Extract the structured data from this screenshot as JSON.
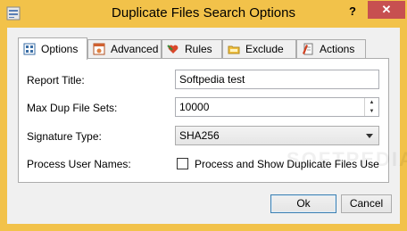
{
  "window": {
    "title": "Duplicate Files Search Options",
    "help_label": "?",
    "close_label": "✕",
    "accent_color": "#f2c24a",
    "close_color": "#c75050"
  },
  "tabs": [
    {
      "label": "Options",
      "icon": "options-grid-icon",
      "active": true
    },
    {
      "label": "Advanced",
      "icon": "advanced-window-icon",
      "active": false
    },
    {
      "label": "Rules",
      "icon": "rules-heart-icon",
      "active": false
    },
    {
      "label": "Exclude",
      "icon": "exclude-folder-icon",
      "active": false
    },
    {
      "label": "Actions",
      "icon": "actions-document-icon",
      "active": false
    }
  ],
  "options": {
    "report_title_label": "Report Title:",
    "report_title_value": "Softpedia test",
    "max_dup_label": "Max Dup File Sets:",
    "max_dup_value": "10000",
    "signature_label": "Signature Type:",
    "signature_value": "SHA256",
    "process_user_label": "Process User Names:",
    "process_user_checkbox_label": "Process and Show Duplicate Files User Names",
    "process_user_checked": false
  },
  "buttons": {
    "ok_label": "Ok",
    "cancel_label": "Cancel"
  },
  "watermark": "SOFTPEDIA"
}
